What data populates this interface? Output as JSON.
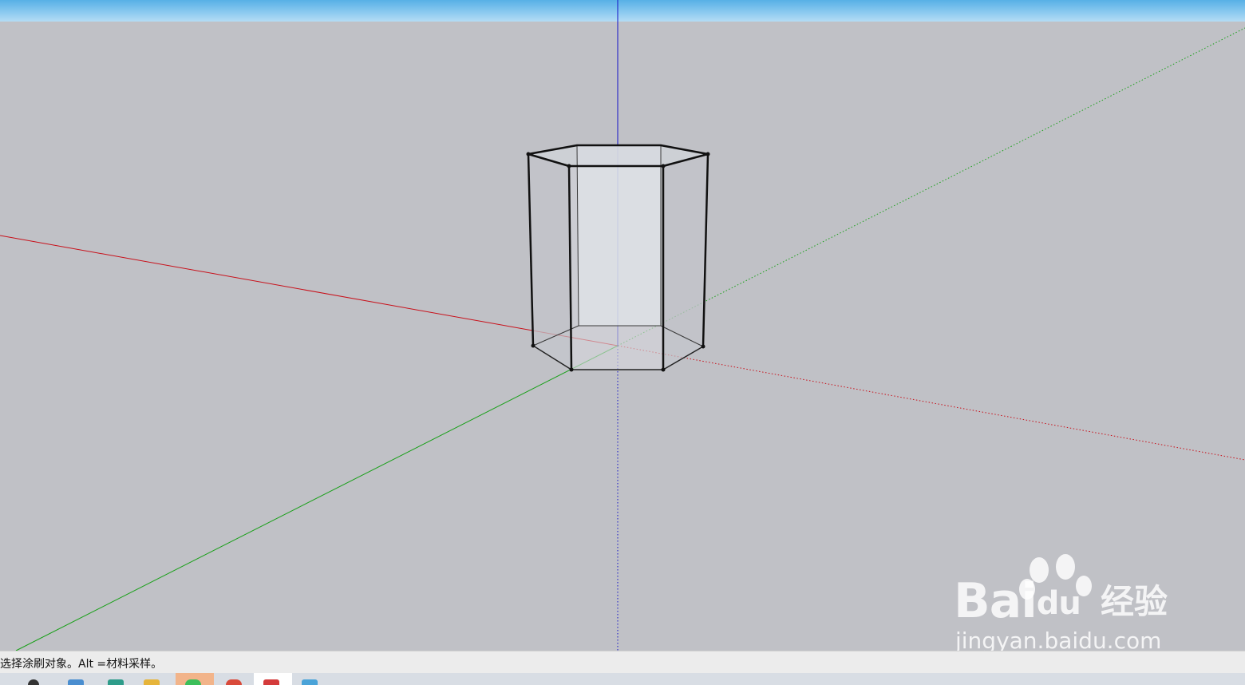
{
  "status_bar": {
    "message": "选择涂刷对象。Alt =材料采样。"
  },
  "axes": {
    "red": "#c8101a",
    "green": "#1aa01a",
    "blue": "#1414c8"
  },
  "colors": {
    "sky": "#7ec3ee",
    "ground": "#c0c1c6",
    "model_edge": "#111111",
    "back_face": "#dfe2e8"
  },
  "model": {
    "shape": "hexagonal-prism",
    "display": "x-ray"
  },
  "watermark": {
    "brand": "Bai",
    "brand_du": "du",
    "brand_cn": "经验",
    "url": "jingyan.baidu.com"
  },
  "taskbar": {
    "icons": [
      "app-icon",
      "app-icon",
      "app-icon",
      "app-icon",
      "app-icon",
      "app-icon",
      "app-icon",
      "app-icon"
    ]
  }
}
